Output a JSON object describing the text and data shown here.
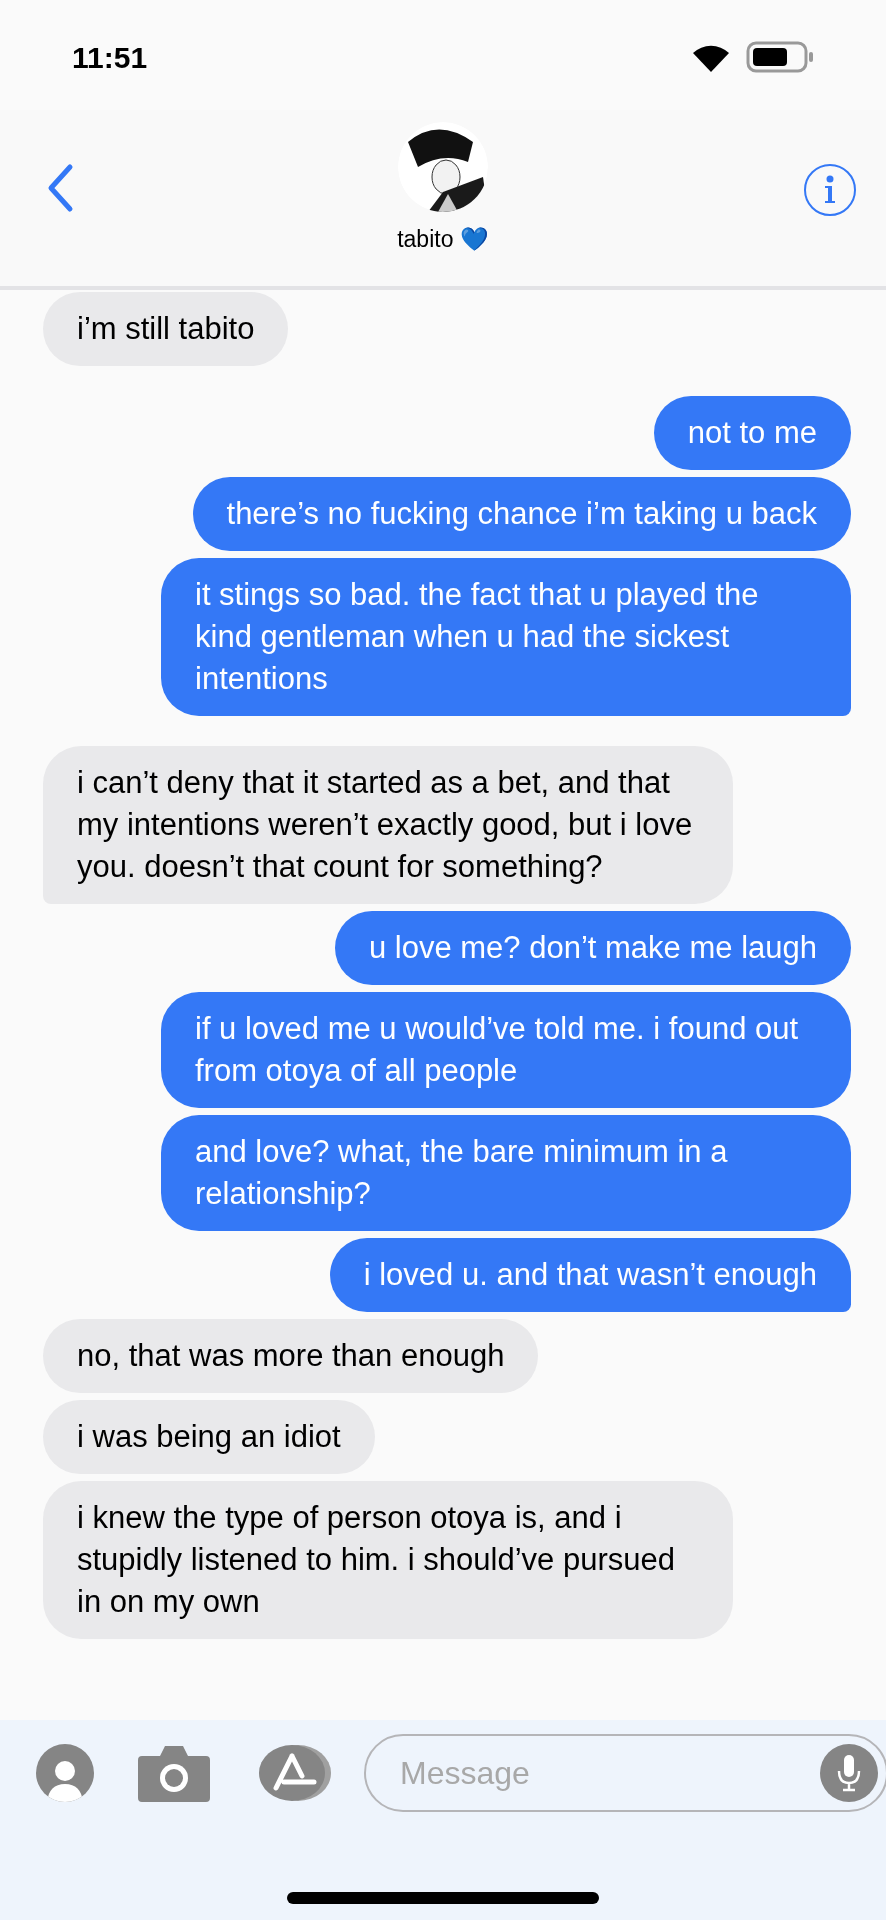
{
  "status_bar": {
    "time": "11:51"
  },
  "header": {
    "contact_name": "tabito 💙"
  },
  "message_groups": [
    {
      "messages": [
        {
          "text": "i’m still tabito",
          "outgoing": false,
          "tail": false
        }
      ]
    },
    {
      "messages": [
        {
          "text": "not to me",
          "outgoing": true,
          "tail": false
        },
        {
          "text": "there’s no fucking chance i’m taking u back",
          "outgoing": true,
          "tail": false
        },
        {
          "text": "it stings so bad. the fact that u played the kind gentleman when u had the sickest intentions",
          "outgoing": true,
          "tail": true
        }
      ]
    },
    {
      "messages": [
        {
          "text": "i can’t deny that it started as a bet, and that my intentions weren’t exactly good, but i love you. doesn’t that count for something?",
          "outgoing": false,
          "tail": true
        },
        {
          "text": "u love me? don’t make me laugh",
          "outgoing": true,
          "tail": false
        },
        {
          "text": "if u loved me u would’ve told me. i found out from otoya of all people",
          "outgoing": true,
          "tail": false
        },
        {
          "text": "and love? what, the bare minimum in a relationship?",
          "outgoing": true,
          "tail": false
        },
        {
          "text": "i loved u. and that wasn’t enough",
          "outgoing": true,
          "tail": true
        },
        {
          "text": "no, that was more than enough",
          "outgoing": false,
          "tail": false
        },
        {
          "text": "i was being an idiot",
          "outgoing": false,
          "tail": false
        },
        {
          "text": "i knew the type of person otoya is, and i stupidly listened to him. i should’ve pursued in on my own",
          "outgoing": false
        }
      ]
    }
  ],
  "composer": {
    "placeholder": "Message"
  }
}
